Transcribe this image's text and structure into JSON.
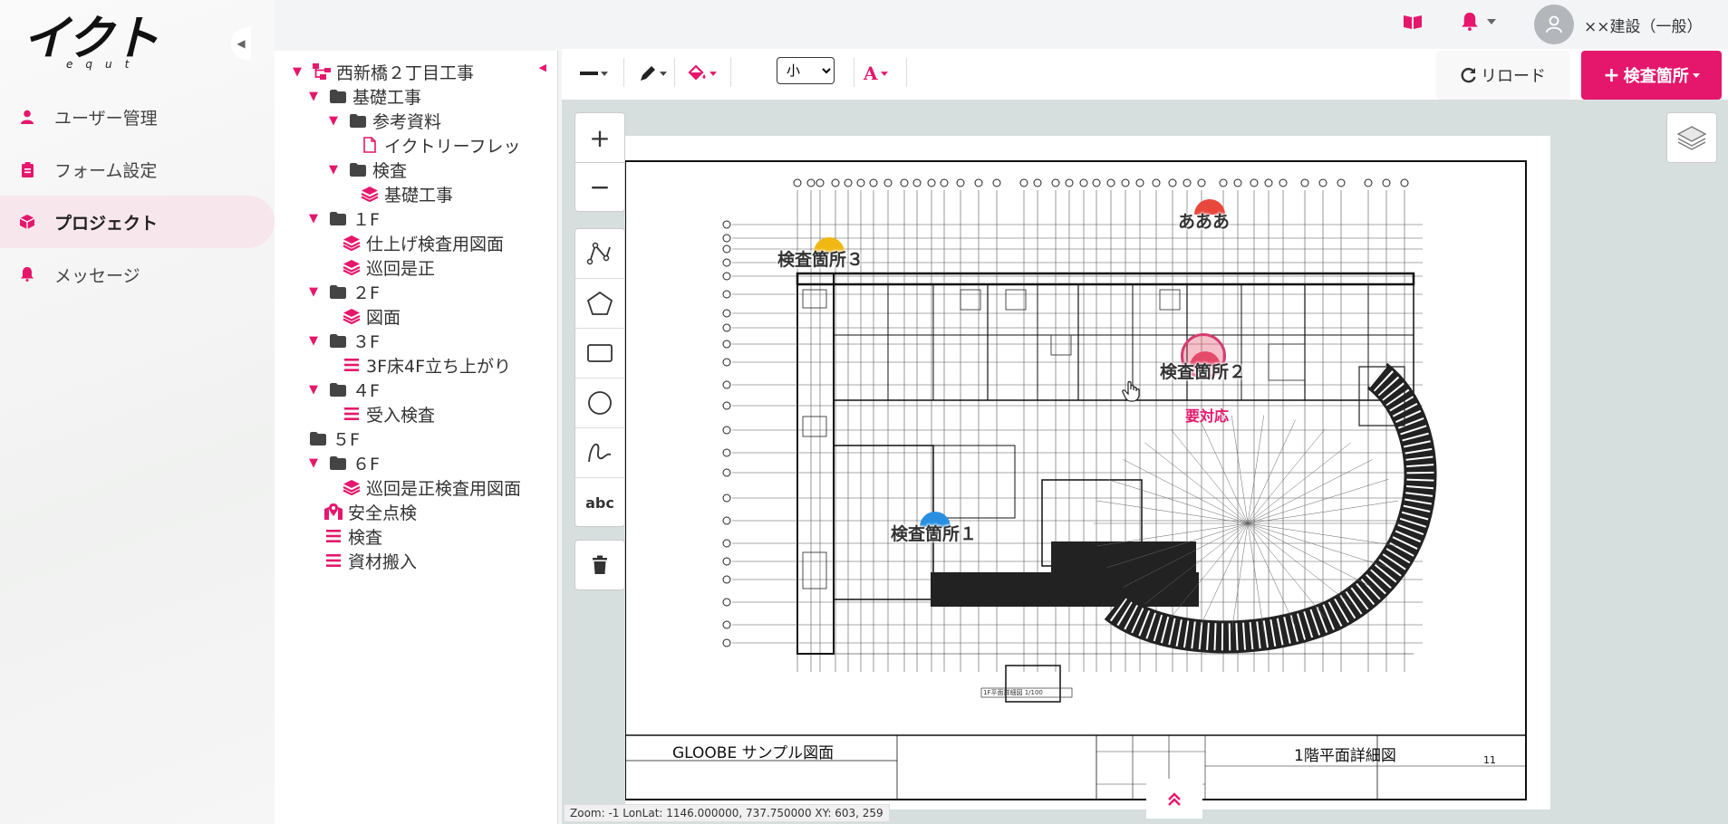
{
  "app": {
    "logo_text": "イクト",
    "logo_sub": "equt"
  },
  "nav": {
    "items": [
      {
        "label": "ユーザー管理",
        "icon": "user-icon",
        "active": false
      },
      {
        "label": "フォーム設定",
        "icon": "clipboard-icon",
        "active": false
      },
      {
        "label": "プロジェクト",
        "icon": "cube-icon",
        "active": true
      },
      {
        "label": "メッセージ",
        "icon": "bell-icon",
        "active": false
      }
    ]
  },
  "header": {
    "user_name": "××建設（一般）"
  },
  "tree": {
    "items": [
      {
        "label": "西新橋２丁目工事",
        "icon": "sitemap-icon",
        "caret": true
      },
      {
        "label": "基礎工事",
        "icon": "folder-icon",
        "caret": true
      },
      {
        "label": "参考資料",
        "icon": "folder-icon",
        "caret": true
      },
      {
        "label": "イクトリーフレッ",
        "icon": "file-icon",
        "caret": false
      },
      {
        "label": "検査",
        "icon": "folder-icon",
        "caret": true
      },
      {
        "label": "基礎工事",
        "icon": "layers-icon",
        "caret": false
      },
      {
        "label": "１F",
        "icon": "folder-icon",
        "caret": true
      },
      {
        "label": "仕上げ検査用図面",
        "icon": "layers-icon",
        "caret": false
      },
      {
        "label": "巡回是正",
        "icon": "layers-icon",
        "caret": false
      },
      {
        "label": "２F",
        "icon": "folder-icon",
        "caret": true
      },
      {
        "label": "図面",
        "icon": "layers-icon",
        "caret": false
      },
      {
        "label": "３F",
        "icon": "folder-icon",
        "caret": true
      },
      {
        "label": "3F床4F立ち上がり",
        "icon": "list-icon",
        "caret": false
      },
      {
        "label": "４F",
        "icon": "folder-icon",
        "caret": true
      },
      {
        "label": "受入検査",
        "icon": "list-icon",
        "caret": false
      },
      {
        "label": "５F",
        "icon": "folder-icon",
        "caret": false
      },
      {
        "label": "６F",
        "icon": "folder-icon",
        "caret": true
      },
      {
        "label": "巡回是正検査用図面",
        "icon": "layers-icon",
        "caret": false
      },
      {
        "label": "安全点検",
        "icon": "map-marker-icon",
        "caret": false
      },
      {
        "label": "検査",
        "icon": "list-icon",
        "caret": false
      },
      {
        "label": "資材搬入",
        "icon": "list-icon",
        "caret": false
      }
    ]
  },
  "toolbar": {
    "size_selected": "小",
    "size_options": [
      "小"
    ],
    "reload_label": "リロード",
    "add_label": "検査箇所"
  },
  "markers": [
    {
      "label": "あああ",
      "color": "#e8473c"
    },
    {
      "label": "検査箇所３",
      "color": "#f1b814"
    },
    {
      "label": "検査箇所２",
      "color": "#e54a6a",
      "sub": "要対応"
    },
    {
      "label": "検査箇所１",
      "color": "#2a8fe0"
    }
  ],
  "drawing": {
    "sheet_title": "GLOOBE サンプル図面",
    "plan_title": "1階平面詳細図",
    "sheet_number": "11",
    "scale_note": "1F平面詳細図 1/100"
  },
  "status": {
    "text": "Zoom: -1 LonLat: 1146.000000, 737.750000 XY: 603, 259"
  },
  "colors": {
    "accent": "#e5176c",
    "map_bg": "#d7dfde"
  }
}
